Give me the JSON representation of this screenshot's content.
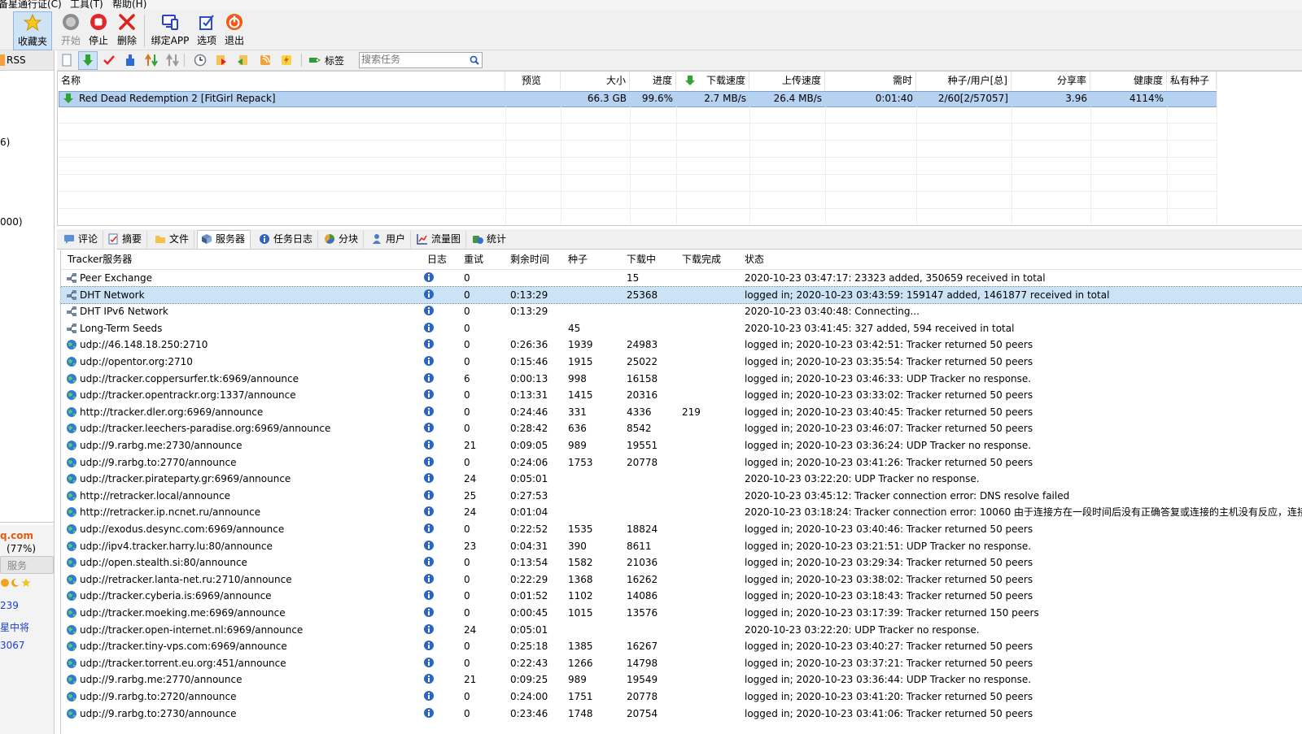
{
  "menu": [
    {
      "label": "备星通行证(C)"
    },
    {
      "label": "工具(T)"
    },
    {
      "label": "帮助(H)"
    }
  ],
  "toolbar": {
    "buttons": [
      {
        "label": "收藏夹",
        "icon": "star-icon"
      },
      {
        "label": "开始",
        "icon": "start-icon"
      },
      {
        "label": "停止",
        "icon": "stop-icon"
      },
      {
        "label": "删除",
        "icon": "delete-icon"
      },
      {
        "label": "绑定APP",
        "icon": "bind-app-icon"
      },
      {
        "label": "选项",
        "icon": "options-icon"
      },
      {
        "label": "退出",
        "icon": "exit-icon"
      }
    ]
  },
  "toolbar2": {
    "tag_label": "标签",
    "search_placeholder": "搜索任务"
  },
  "leftpanel": {
    "rss": "RSS",
    "count1": "6)",
    "count2": "000)",
    "domain": "q.com",
    "service": "服务",
    "percent": "(77%)",
    "number": "239",
    "rank": "星中将",
    "number2": "3067"
  },
  "tasklist": {
    "columns": [
      "名称",
      "预览",
      "大小",
      "进度",
      "下载速度",
      "上传速度",
      "需时",
      "种子/用户[总]",
      "分享率",
      "健康度",
      "私有种子"
    ],
    "rows": [
      {
        "name": "Red Dead Redemption 2 [FitGirl Repack]",
        "preview": "",
        "size": "66.3 GB",
        "progress": "99.6%",
        "down": "2.7 MB/s",
        "up": "26.4 MB/s",
        "eta": "0:01:40",
        "seeds": "2/60[2/57057]",
        "ratio": "3.96",
        "health": "4114%",
        "private": ""
      }
    ]
  },
  "tabs": [
    {
      "label": "评论",
      "icon": "comment-icon"
    },
    {
      "label": "摘要",
      "icon": "summary-icon"
    },
    {
      "label": "文件",
      "icon": "files-icon"
    },
    {
      "label": "服务器",
      "icon": "server-icon"
    },
    {
      "label": "任务日志",
      "icon": "log-icon"
    },
    {
      "label": "分块",
      "icon": "pieces-icon"
    },
    {
      "label": "用户",
      "icon": "user-icon"
    },
    {
      "label": "流量图",
      "icon": "traffic-icon"
    },
    {
      "label": "统计",
      "icon": "stats-icon"
    }
  ],
  "trackers": {
    "columns": [
      "Tracker服务器",
      "日志",
      "重试",
      "剩余时间",
      "种子",
      "下载中",
      "下载完成",
      "状态"
    ],
    "rows": [
      {
        "name": "Peer Exchange",
        "retry": "0",
        "remain": "",
        "seeds": "",
        "downloading": "15",
        "done": "",
        "status": "2020-10-23 03:47:17: 23323 added, 350659 received in total",
        "kind": "peer"
      },
      {
        "name": "DHT Network",
        "retry": "0",
        "remain": "0:13:29",
        "seeds": "",
        "downloading": "25368",
        "done": "",
        "status": "logged in; 2020-10-23 03:43:59: 159147 added, 1461877 received in total",
        "kind": "peer",
        "selected": true
      },
      {
        "name": "DHT IPv6 Network",
        "retry": "0",
        "remain": "0:13:29",
        "seeds": "",
        "downloading": "",
        "done": "",
        "status": "2020-10-23 03:40:48: Connecting...",
        "kind": "peer"
      },
      {
        "name": "Long-Term Seeds",
        "retry": "0",
        "remain": "",
        "seeds": "45",
        "downloading": "",
        "done": "",
        "status": "2020-10-23 03:41:45: 327 added, 594 received in total",
        "kind": "peer"
      },
      {
        "name": "udp://46.148.18.250:2710",
        "retry": "0",
        "remain": "0:26:36",
        "seeds": "1939",
        "downloading": "24983",
        "done": "",
        "status": "logged in; 2020-10-23 03:42:51: Tracker returned 50 peers",
        "kind": "globe"
      },
      {
        "name": "udp://opentor.org:2710",
        "retry": "0",
        "remain": "0:15:46",
        "seeds": "1915",
        "downloading": "25022",
        "done": "",
        "status": "logged in; 2020-10-23 03:35:54: Tracker returned 50 peers",
        "kind": "globe"
      },
      {
        "name": "udp://tracker.coppersurfer.tk:6969/announce",
        "retry": "6",
        "remain": "0:00:13",
        "seeds": "998",
        "downloading": "16158",
        "done": "",
        "status": "logged in; 2020-10-23 03:46:33: UDP Tracker no response.",
        "kind": "globe"
      },
      {
        "name": "udp://tracker.opentrackr.org:1337/announce",
        "retry": "0",
        "remain": "0:13:31",
        "seeds": "1415",
        "downloading": "20316",
        "done": "",
        "status": "logged in; 2020-10-23 03:33:02: Tracker returned 50 peers",
        "kind": "globe"
      },
      {
        "name": "http://tracker.dler.org:6969/announce",
        "retry": "0",
        "remain": "0:24:46",
        "seeds": "331",
        "downloading": "4336",
        "done": "219",
        "status": "logged in; 2020-10-23 03:40:45: Tracker returned 50 peers",
        "kind": "globe"
      },
      {
        "name": "udp://tracker.leechers-paradise.org:6969/announce",
        "retry": "0",
        "remain": "0:28:42",
        "seeds": "636",
        "downloading": "8542",
        "done": "",
        "status": "logged in; 2020-10-23 03:46:07: Tracker returned 50 peers",
        "kind": "globe"
      },
      {
        "name": "udp://9.rarbg.me:2730/announce",
        "retry": "21",
        "remain": "0:09:05",
        "seeds": "989",
        "downloading": "19551",
        "done": "",
        "status": "logged in; 2020-10-23 03:36:24: UDP Tracker no response.",
        "kind": "globe"
      },
      {
        "name": "udp://9.rarbg.to:2770/announce",
        "retry": "0",
        "remain": "0:24:06",
        "seeds": "1753",
        "downloading": "20778",
        "done": "",
        "status": "logged in; 2020-10-23 03:41:26: Tracker returned 50 peers",
        "kind": "globe"
      },
      {
        "name": "udp://tracker.pirateparty.gr:6969/announce",
        "retry": "24",
        "remain": "0:05:01",
        "seeds": "",
        "downloading": "",
        "done": "",
        "status": "2020-10-23 03:22:20: UDP Tracker no response.",
        "kind": "globe"
      },
      {
        "name": "http://retracker.local/announce",
        "retry": "25",
        "remain": "0:27:53",
        "seeds": "",
        "downloading": "",
        "done": "",
        "status": "2020-10-23 03:45:12: Tracker connection error: DNS resolve failed",
        "kind": "globe"
      },
      {
        "name": "http://retracker.ip.ncnet.ru/announce",
        "retry": "24",
        "remain": "0:01:04",
        "seeds": "",
        "downloading": "",
        "done": "",
        "status": "2020-10-23 03:18:24: Tracker connection error: 10060 由于连接方在一段时间后没有正确答复或连接的主机没有反应，连接",
        "kind": "globe"
      },
      {
        "name": "udp://exodus.desync.com:6969/announce",
        "retry": "0",
        "remain": "0:22:52",
        "seeds": "1535",
        "downloading": "18824",
        "done": "",
        "status": "logged in; 2020-10-23 03:40:46: Tracker returned 50 peers",
        "kind": "globe"
      },
      {
        "name": "udp://ipv4.tracker.harry.lu:80/announce",
        "retry": "23",
        "remain": "0:04:31",
        "seeds": "390",
        "downloading": "8611",
        "done": "",
        "status": "logged in; 2020-10-23 03:21:51: UDP Tracker no response.",
        "kind": "globe"
      },
      {
        "name": "udp://open.stealth.si:80/announce",
        "retry": "0",
        "remain": "0:13:54",
        "seeds": "1582",
        "downloading": "21036",
        "done": "",
        "status": "logged in; 2020-10-23 03:29:34: Tracker returned 50 peers",
        "kind": "globe"
      },
      {
        "name": "udp://retracker.lanta-net.ru:2710/announce",
        "retry": "0",
        "remain": "0:22:29",
        "seeds": "1368",
        "downloading": "16262",
        "done": "",
        "status": "logged in; 2020-10-23 03:38:02: Tracker returned 50 peers",
        "kind": "globe"
      },
      {
        "name": "udp://tracker.cyberia.is:6969/announce",
        "retry": "0",
        "remain": "0:01:52",
        "seeds": "1102",
        "downloading": "14086",
        "done": "",
        "status": "logged in; 2020-10-23 03:18:43: Tracker returned 50 peers",
        "kind": "globe"
      },
      {
        "name": "udp://tracker.moeking.me:6969/announce",
        "retry": "0",
        "remain": "0:00:45",
        "seeds": "1015",
        "downloading": "13576",
        "done": "",
        "status": "logged in; 2020-10-23 03:17:39: Tracker returned 150 peers",
        "kind": "globe"
      },
      {
        "name": "udp://tracker.open-internet.nl:6969/announce",
        "retry": "24",
        "remain": "0:05:01",
        "seeds": "",
        "downloading": "",
        "done": "",
        "status": "2020-10-23 03:22:20: UDP Tracker no response.",
        "kind": "globe"
      },
      {
        "name": "udp://tracker.tiny-vps.com:6969/announce",
        "retry": "0",
        "remain": "0:25:18",
        "seeds": "1385",
        "downloading": "16267",
        "done": "",
        "status": "logged in; 2020-10-23 03:40:27: Tracker returned 50 peers",
        "kind": "globe"
      },
      {
        "name": "udp://tracker.torrent.eu.org:451/announce",
        "retry": "0",
        "remain": "0:22:43",
        "seeds": "1266",
        "downloading": "14798",
        "done": "",
        "status": "logged in; 2020-10-23 03:37:21: Tracker returned 50 peers",
        "kind": "globe"
      },
      {
        "name": "udp://9.rarbg.me:2770/announce",
        "retry": "21",
        "remain": "0:09:25",
        "seeds": "989",
        "downloading": "19549",
        "done": "",
        "status": "logged in; 2020-10-23 03:36:44: UDP Tracker no response.",
        "kind": "globe"
      },
      {
        "name": "udp://9.rarbg.to:2720/announce",
        "retry": "0",
        "remain": "0:24:00",
        "seeds": "1751",
        "downloading": "20778",
        "done": "",
        "status": "logged in; 2020-10-23 03:41:20: Tracker returned 50 peers",
        "kind": "globe"
      },
      {
        "name": "udp://9.rarbg.to:2730/announce",
        "retry": "0",
        "remain": "0:23:46",
        "seeds": "1748",
        "downloading": "20754",
        "done": "",
        "status": "logged in; 2020-10-23 03:41:06: Tracker returned 50 peers",
        "kind": "globe"
      }
    ]
  },
  "colors": {
    "selection": "#cce3f6",
    "task_selection": "#b6d2f0",
    "link_blue": "#1a3fd6",
    "brand_orange": "#e25b0e"
  }
}
